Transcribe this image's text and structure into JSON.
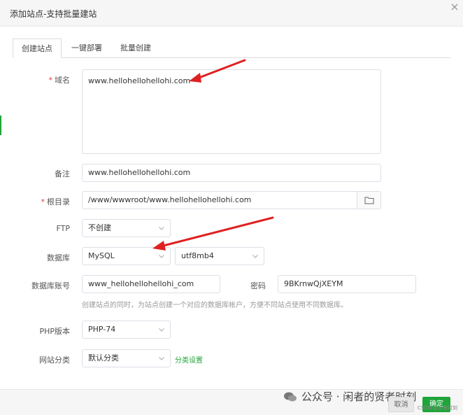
{
  "dialog": {
    "title": "添加站点-支持批量建站"
  },
  "tabs": [
    {
      "label": "创建站点",
      "active": true
    },
    {
      "label": "一键部署",
      "active": false
    },
    {
      "label": "批量创建",
      "active": false
    }
  ],
  "form": {
    "domain": {
      "required_mark": "*",
      "label": "域名",
      "value": "www.hellohellohellohi.com"
    },
    "remark": {
      "label": "备注",
      "value": "www.hellohellohellohi.com"
    },
    "root": {
      "required_mark": "*",
      "label": "根目录",
      "value": "/www/wwwroot/www.hellohellohellohi.com"
    },
    "ftp": {
      "label": "FTP",
      "value": "不创建"
    },
    "database": {
      "label": "数据库",
      "type": "MySQL",
      "charset": "utf8mb4"
    },
    "db_account": {
      "label": "数据库账号",
      "value": "www_hellohellohellohi_com",
      "password_label": "密码",
      "password": "9BKrnwQjXEYM"
    },
    "db_hint": "创建站点的同时，为站点创建一个对应的数据库帐户，方便不同站点使用不同数据库。",
    "php": {
      "label": "PHP版本",
      "value": "PHP-74"
    },
    "category": {
      "label": "网站分类",
      "value": "默认分类",
      "link": "分类设置"
    }
  },
  "footer": {
    "cancel": "取消",
    "ok": "确定"
  },
  "watermark": {
    "text": "公众号 · 闲者的贤者时刻",
    "small": "CSDN @贤者时刻"
  },
  "colors": {
    "accent": "#20a53a",
    "arrow": "#e02020"
  }
}
